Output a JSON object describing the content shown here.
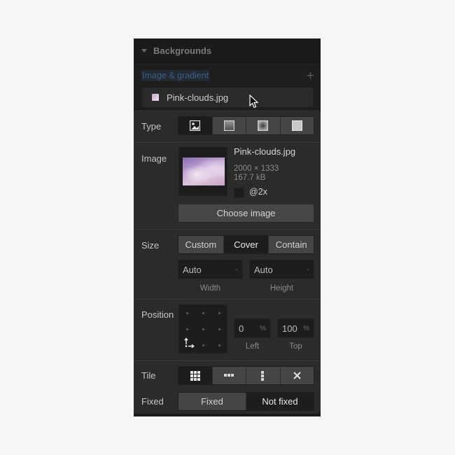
{
  "section": {
    "title": "Backgrounds"
  },
  "layers": {
    "label": "Image & gradient",
    "add_icon": "plus-icon",
    "items": [
      {
        "name": "Pink-clouds.jpg"
      }
    ]
  },
  "popover": {
    "type": {
      "label": "Type",
      "options": [
        {
          "icon": "image-icon",
          "active": true
        },
        {
          "icon": "linear-gradient-icon",
          "active": false
        },
        {
          "icon": "radial-gradient-icon",
          "active": false
        },
        {
          "icon": "solid-color-icon",
          "active": false
        }
      ]
    },
    "image": {
      "label": "Image",
      "file_name": "Pink-clouds.jpg",
      "dimensions": "2000 × 1333",
      "file_size": "167.7 kB",
      "retina_label": "@2x",
      "retina_checked": false,
      "choose_button": "Choose image"
    },
    "size": {
      "label": "Size",
      "options": [
        {
          "label": "Custom",
          "active": false
        },
        {
          "label": "Cover",
          "active": true
        },
        {
          "label": "Contain",
          "active": false
        }
      ],
      "width": {
        "value": "Auto",
        "unit": "-",
        "caption": "Width"
      },
      "height": {
        "value": "Auto",
        "unit": "-",
        "caption": "Height"
      }
    },
    "position": {
      "label": "Position",
      "selected_anchor": "bottom-left",
      "left": {
        "value": "0",
        "unit": "%",
        "caption": "Left"
      },
      "top": {
        "value": "100",
        "unit": "%",
        "caption": "Top"
      }
    },
    "tile": {
      "label": "Tile",
      "options": [
        {
          "icon": "tile-both-icon",
          "active": true
        },
        {
          "icon": "tile-horizontal-icon",
          "active": false
        },
        {
          "icon": "tile-vertical-icon",
          "active": false
        },
        {
          "icon": "no-tile-icon",
          "active": false
        }
      ]
    },
    "fixed": {
      "label": "Fixed",
      "options": [
        {
          "label": "Fixed",
          "active": false
        },
        {
          "label": "Not fixed",
          "active": true
        }
      ]
    }
  }
}
